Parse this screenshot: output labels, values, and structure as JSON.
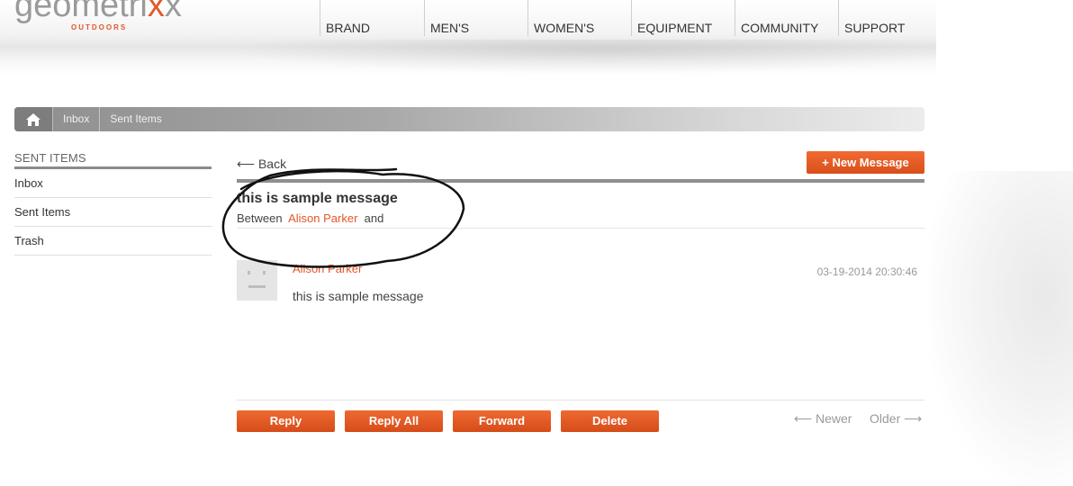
{
  "logo": {
    "word_main": "geometri",
    "word_x": "x",
    "word_end": "x",
    "sub": "OUTDOORS"
  },
  "nav": [
    {
      "label": "BRAND"
    },
    {
      "label": "MEN'S"
    },
    {
      "label": "WOMEN'S"
    },
    {
      "label": "EQUIPMENT"
    },
    {
      "label": "COMMUNITY"
    },
    {
      "label": "SUPPORT"
    }
  ],
  "breadcrumb": {
    "home_icon": "home-icon",
    "items": [
      "Inbox",
      "Sent Items"
    ]
  },
  "sidebar": {
    "title": "SENT ITEMS",
    "items": [
      {
        "label": "Inbox"
      },
      {
        "label": "Sent Items"
      },
      {
        "label": "Trash"
      }
    ]
  },
  "main": {
    "back_label": "Back",
    "new_message_label": "+ New Message",
    "subject": "this is sample message",
    "between_label": "Between",
    "between_name": "Alison Parker",
    "between_and": "and",
    "message": {
      "sender": "Alison Parker",
      "date": "03-19-2014 20:30:46",
      "body": "this is sample message"
    },
    "actions": {
      "reply": "Reply",
      "reply_all": "Reply All",
      "forward": "Forward",
      "delete": "Delete"
    },
    "pager": {
      "newer": "Newer",
      "older": "Older"
    }
  },
  "colors": {
    "accent": "#e2572a",
    "breadcrumb_dark": "#8e8e8e"
  }
}
